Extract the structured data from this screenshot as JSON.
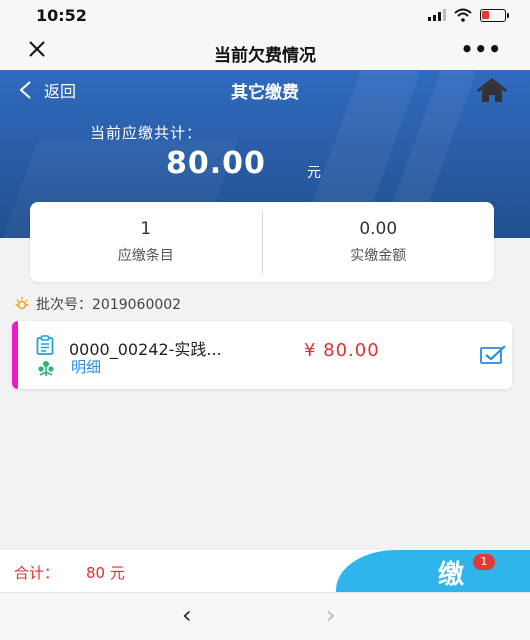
{
  "status": {
    "time": "10:52",
    "battery_level": 0.35
  },
  "topnav": {
    "title": "当前欠费情况",
    "more": "•••"
  },
  "header": {
    "back_label": "返回",
    "title": "其它缴费"
  },
  "due": {
    "label": "当前应缴共计：",
    "amount": "80.00",
    "unit": "元"
  },
  "summary": [
    {
      "value": "1",
      "label": "应缴条目"
    },
    {
      "value": "0.00",
      "label": "实缴金额"
    }
  ],
  "batch": {
    "text": "批次号：2019060002"
  },
  "items": [
    {
      "name": "0000_00242-实践...",
      "detail_label": "明细",
      "price": "¥ 80.00",
      "accent_color": "#e91ec8",
      "checked": true
    }
  ],
  "footer": {
    "total_label": "合计：",
    "total_value": "80 元",
    "pay_glyph": "缴",
    "badge": "1"
  },
  "colors": {
    "accent_blue": "#2f6bbf",
    "price_red": "#e03030",
    "link_blue": "#2b8be0",
    "pay_blue": "#2fb4ec"
  }
}
